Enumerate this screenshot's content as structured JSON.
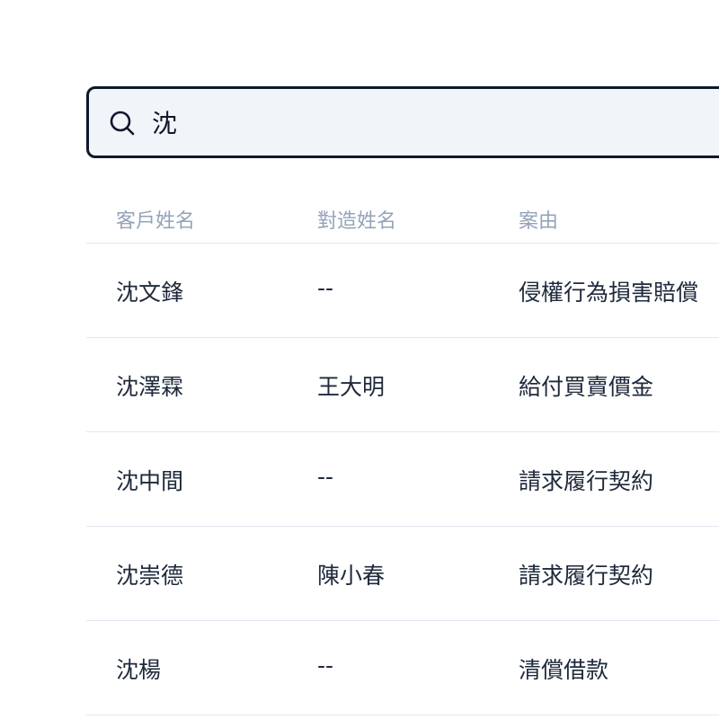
{
  "search": {
    "value": "沈",
    "icon": "search-icon"
  },
  "table": {
    "headers": [
      "客戶姓名",
      "對造姓名",
      "案由"
    ],
    "rows": [
      [
        "沈文鋒",
        "--",
        "侵權行為損害賠償"
      ],
      [
        "沈澤霖",
        "王大明",
        "給付買賣價金"
      ],
      [
        "沈中間",
        "--",
        "請求履行契約"
      ],
      [
        "沈崇德",
        "陳小春",
        "請求履行契約"
      ],
      [
        "沈楊",
        "--",
        "清償借款"
      ]
    ]
  },
  "colors": {
    "border": "#0f172a",
    "input_bg": "#f1f5f9",
    "header_text": "#94a3b8",
    "body_text": "#1e293b",
    "divider": "#e2e8f0"
  }
}
